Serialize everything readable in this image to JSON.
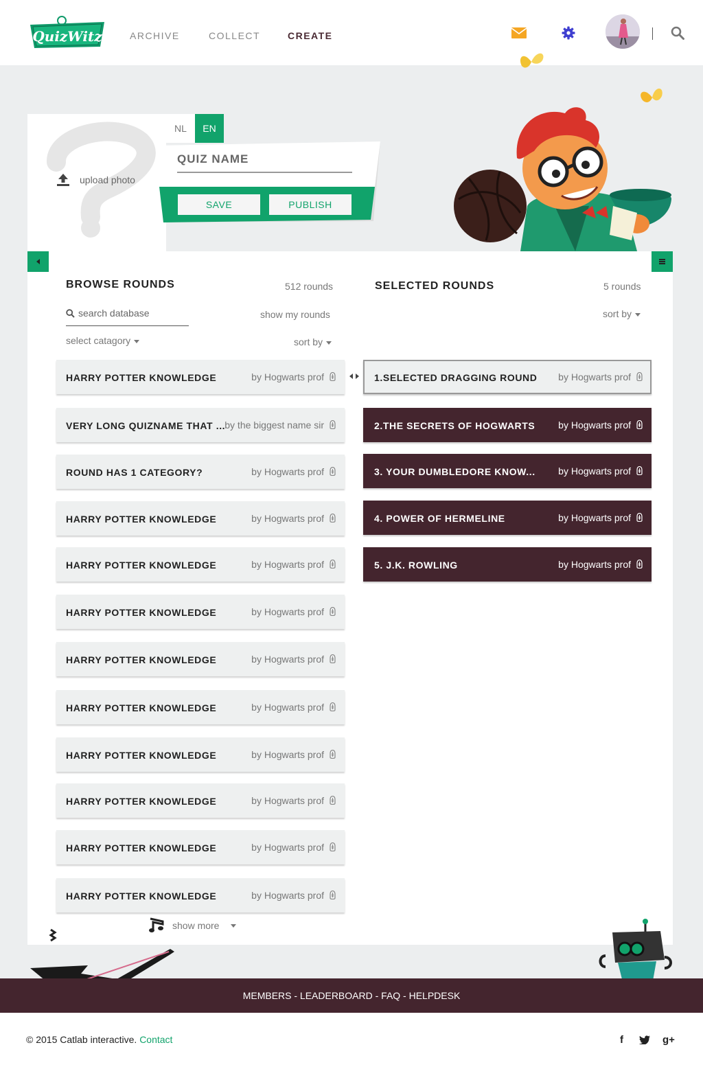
{
  "header": {
    "logo_text": "QuizWitz",
    "nav": [
      {
        "label": "ARCHIVE"
      },
      {
        "label": "COLLECT"
      },
      {
        "label": "CREATE"
      }
    ]
  },
  "editor": {
    "upload_label": "upload photo",
    "languages": [
      "NL",
      "EN"
    ],
    "active_language": "EN",
    "quiz_name_placeholder": "QUIZ NAME",
    "save_label": "SAVE",
    "publish_label": "PUBLISH"
  },
  "browse": {
    "title": "BROWSE ROUNDS",
    "count": "512 rounds",
    "search_placeholder": "search database",
    "show_my_rounds": "show my rounds",
    "category_label": "select catagory",
    "sort_label": "sort by",
    "rounds": [
      {
        "name": "HARRY POTTER KNOWLEDGE",
        "author": "by Hogwarts prof"
      },
      {
        "name": "VERY LONG QUIZNAME THAT ...",
        "author": "by the biggest name sir"
      },
      {
        "name": "ROUND HAS 1 CATEGORY?",
        "author": "by Hogwarts prof"
      },
      {
        "name": "HARRY POTTER KNOWLEDGE",
        "author": "by Hogwarts prof"
      },
      {
        "name": "HARRY POTTER KNOWLEDGE",
        "author": "by Hogwarts prof"
      },
      {
        "name": "HARRY POTTER KNOWLEDGE",
        "author": "by Hogwarts prof"
      },
      {
        "name": "HARRY POTTER KNOWLEDGE",
        "author": "by Hogwarts prof"
      },
      {
        "name": "HARRY POTTER KNOWLEDGE",
        "author": "by Hogwarts prof"
      },
      {
        "name": "HARRY POTTER KNOWLEDGE",
        "author": "by Hogwarts prof"
      },
      {
        "name": "HARRY POTTER KNOWLEDGE",
        "author": "by Hogwarts prof"
      },
      {
        "name": "HARRY POTTER KNOWLEDGE",
        "author": "by Hogwarts prof"
      },
      {
        "name": "HARRY POTTER KNOWLEDGE",
        "author": "by Hogwarts prof"
      }
    ],
    "show_more": "show more"
  },
  "selected": {
    "title": "SELECTED ROUNDS",
    "count": "5 rounds",
    "sort_label": "sort by",
    "rounds": [
      {
        "name": "1.SELECTED DRAGGING ROUND",
        "author": "by Hogwarts prof"
      },
      {
        "name": "2.THE SECRETS OF HOGWARTS",
        "author": "by Hogwarts prof"
      },
      {
        "name": "3. YOUR DUMBLEDORE KNOW...",
        "author": "by Hogwarts prof"
      },
      {
        "name": "4. POWER OF HERMELINE",
        "author": "by Hogwarts prof"
      },
      {
        "name": "5. J.K. ROWLING",
        "author": "by Hogwarts prof"
      }
    ]
  },
  "footer": {
    "links": "MEMBERS - LEADERBOARD - FAQ - HELPDESK",
    "copyright": "© 2015 Catlab interactive.",
    "contact": "Contact",
    "social": [
      "f",
      "t",
      "g+"
    ]
  },
  "colors": {
    "brand_green": "#11a36b",
    "dark_maroon": "#44252e",
    "mail_icon": "#f5a623",
    "settings_icon": "#3f3fd0"
  },
  "icons": [
    "mail-icon",
    "gear-icon",
    "search-icon",
    "upload-icon",
    "lock-icon",
    "menu-icon",
    "arrow-left-icon",
    "drag-handle-icon",
    "music-note-icon"
  ]
}
